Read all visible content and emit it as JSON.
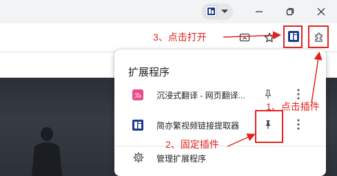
{
  "popup": {
    "title": "扩展程序",
    "extensions": [
      {
        "name": "沉浸式翻译 - 网页翻译...",
        "icon": "immersive-translate-icon",
        "pinned": false
      },
      {
        "name": "简亦繁视频链接提取器",
        "icon": "video-link-extractor-icon",
        "pinned": true
      }
    ],
    "manage_label": "管理扩展程序"
  },
  "annotations": {
    "step1": "1、点击插件",
    "step2": "2、固定插件",
    "step3": "3、点击打开"
  },
  "colors": {
    "annotation": "#e2211c",
    "titlebar": "#f1f3f4",
    "ext_icon_blue": "#1a3a8a",
    "translate_pink": "#ec4c8a"
  },
  "icons": {
    "profile": "profile-avatar-icon",
    "minimize": "minimize-icon",
    "maximize": "restore-icon",
    "close": "close-icon",
    "cast": "cast-icon",
    "bookmark": "star-icon",
    "extensions": "puzzle-icon",
    "pin": "pin-icon",
    "more": "more-vertical-icon",
    "settings": "gear-icon"
  }
}
